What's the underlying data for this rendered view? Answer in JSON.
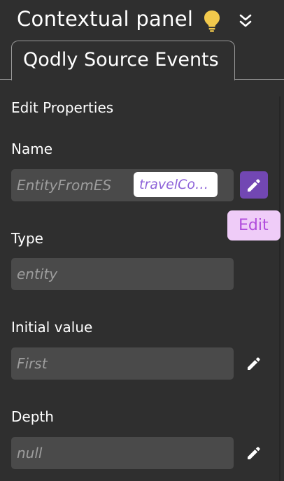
{
  "header": {
    "title": "Contextual panel",
    "icons": [
      "lightbulb-icon",
      "double-chevron-down-icon"
    ]
  },
  "tabs": [
    {
      "label": "Qodly Source Events",
      "active": true
    }
  ],
  "section": {
    "title": "Edit Properties"
  },
  "fields": {
    "name": {
      "label": "Name",
      "value": "EntityFromES",
      "chip": "travelCo…"
    },
    "type": {
      "label": "Type",
      "value": "entity"
    },
    "initial_value": {
      "label": "Initial value",
      "value": "First"
    },
    "depth": {
      "label": "Depth",
      "value": "null"
    }
  },
  "tooltip": {
    "text": "Edit"
  },
  "colors": {
    "background": "#2f2f2f",
    "field_background": "#4a4a4a",
    "accent": "#7247b3",
    "bulb": "#f2c94c",
    "tooltip_background": "#efccf8",
    "tooltip_text": "#b04bdc"
  }
}
